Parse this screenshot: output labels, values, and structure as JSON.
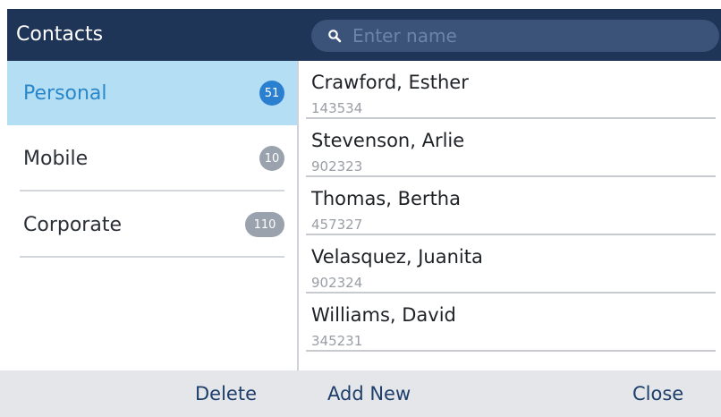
{
  "header": {
    "title": "Contacts",
    "search_placeholder": "Enter name",
    "search_value": ""
  },
  "folders": [
    {
      "label": "Personal",
      "count": "51",
      "selected": true
    },
    {
      "label": "Mobile",
      "count": "10",
      "selected": false
    },
    {
      "label": "Corporate",
      "count": "110",
      "selected": false
    }
  ],
  "contacts": [
    {
      "name": "Crawford, Esther",
      "number": "143534"
    },
    {
      "name": "Stevenson, Arlie",
      "number": "902323"
    },
    {
      "name": "Thomas, Bertha",
      "number": "457327"
    },
    {
      "name": "Velasquez, Juanita",
      "number": "902324"
    },
    {
      "name": "Williams, David",
      "number": "345231"
    }
  ],
  "softkeys": {
    "delete": "Delete",
    "add_new": "Add New",
    "close": "Close"
  },
  "colors": {
    "header_bg": "#1f3557",
    "selected_bg": "#b3def4",
    "selected_text": "#2a87c9",
    "badge_active": "#2b7fd1",
    "badge_inactive": "#9aa3ad",
    "softkey_text": "#1d3e6b"
  },
  "icons": {
    "search": "search-icon"
  }
}
